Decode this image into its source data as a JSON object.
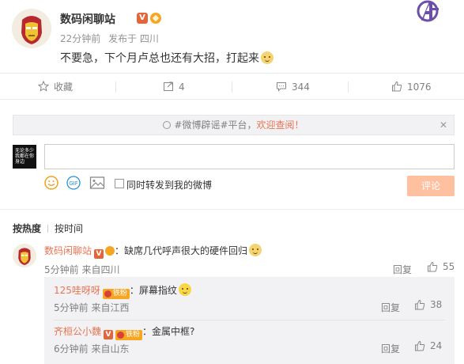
{
  "post": {
    "author": "数码闲聊站",
    "v_badge": "V",
    "time": "22分钟前",
    "location": "发布于 四川",
    "text": "不要急，下个月卢总也还有大招，打起来"
  },
  "actions": {
    "favorite": "收藏",
    "repost_count": "4",
    "comment_count": "344",
    "like_count": "1076"
  },
  "notice": {
    "prefix": "#微博辟谣#平台，",
    "highlight": "欢迎查阅！",
    "close": "✕"
  },
  "composer": {
    "avatar_text": "无论多少 我都在你身边",
    "gif": "GIF",
    "repost_checkbox_label": "同时转发到我的微博",
    "submit": "评论"
  },
  "sort": {
    "hot": "按热度",
    "time": "按时间"
  },
  "comments": [
    {
      "author": "数码闲聊站",
      "v_badge": "V",
      "text": "：缺席几代呼声很大的硬件回归",
      "time": "5分钟前",
      "from": "来自四川",
      "reply": "回复",
      "likes": "55"
    }
  ],
  "replies": [
    {
      "author": "125哇呀呀",
      "fan_badge": "铁粉",
      "text": "：屏幕指纹",
      "time": "5分钟前",
      "from": "来自江西",
      "reply": "回复",
      "likes": "38"
    },
    {
      "author": "齐桓公小魏",
      "v_badge": "V",
      "fan_badge": "铁粉",
      "text": "：金属中框?",
      "time": "6分钟前",
      "from": "来自山东",
      "reply": "回复",
      "likes": "24"
    }
  ],
  "colors": {
    "accent": "#eb7350",
    "submit_disabled": "#ffc09f",
    "v_badge": "#e4653a",
    "fan_badge": "#f6a623"
  }
}
